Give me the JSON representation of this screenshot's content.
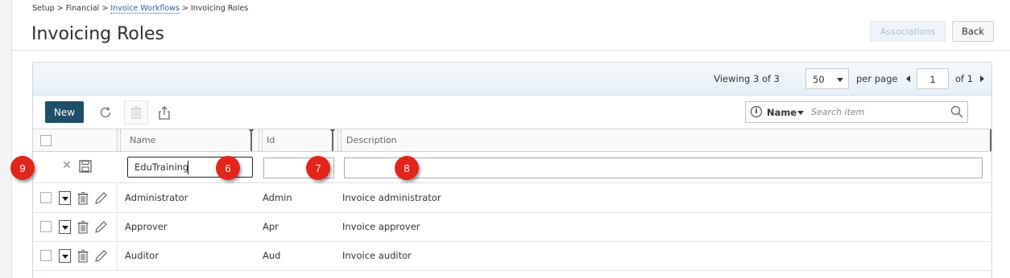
{
  "breadcrumb": {
    "items": [
      {
        "label": "Setup",
        "link": false
      },
      {
        "label": "Financial",
        "link": false
      },
      {
        "label": "Invoice Workflows",
        "link": true
      },
      {
        "label": "Invoicing Roles",
        "link": false
      }
    ],
    "separator": ">"
  },
  "page": {
    "title": "Invoicing Roles"
  },
  "header_buttons": {
    "associations": "Associations",
    "back": "Back"
  },
  "pager": {
    "viewing_prefix": "Viewing",
    "viewing_count": "3 of 3",
    "per_page_value": "50",
    "per_page_label": "per page",
    "current_page": "1",
    "total_pages": "of 1"
  },
  "toolbar": {
    "new_label": "New",
    "search_field": "Name",
    "search_placeholder": "Search item"
  },
  "table": {
    "columns": [
      "Name",
      "Id",
      "Description"
    ],
    "edit_row": {
      "name": "EduTraining",
      "id": "",
      "description": ""
    },
    "rows": [
      {
        "name": "Administrator",
        "id": "Admin",
        "description": "Invoice administrator"
      },
      {
        "name": "Approver",
        "id": "Apr",
        "description": "Invoice approver"
      },
      {
        "name": "Auditor",
        "id": "Aud",
        "description": "Invoice auditor"
      }
    ]
  },
  "callouts": [
    "9",
    "6",
    "7",
    "8"
  ],
  "colors": {
    "primary": "#1d4f6b",
    "link": "#2a62a8",
    "callout": "#e2241b"
  }
}
